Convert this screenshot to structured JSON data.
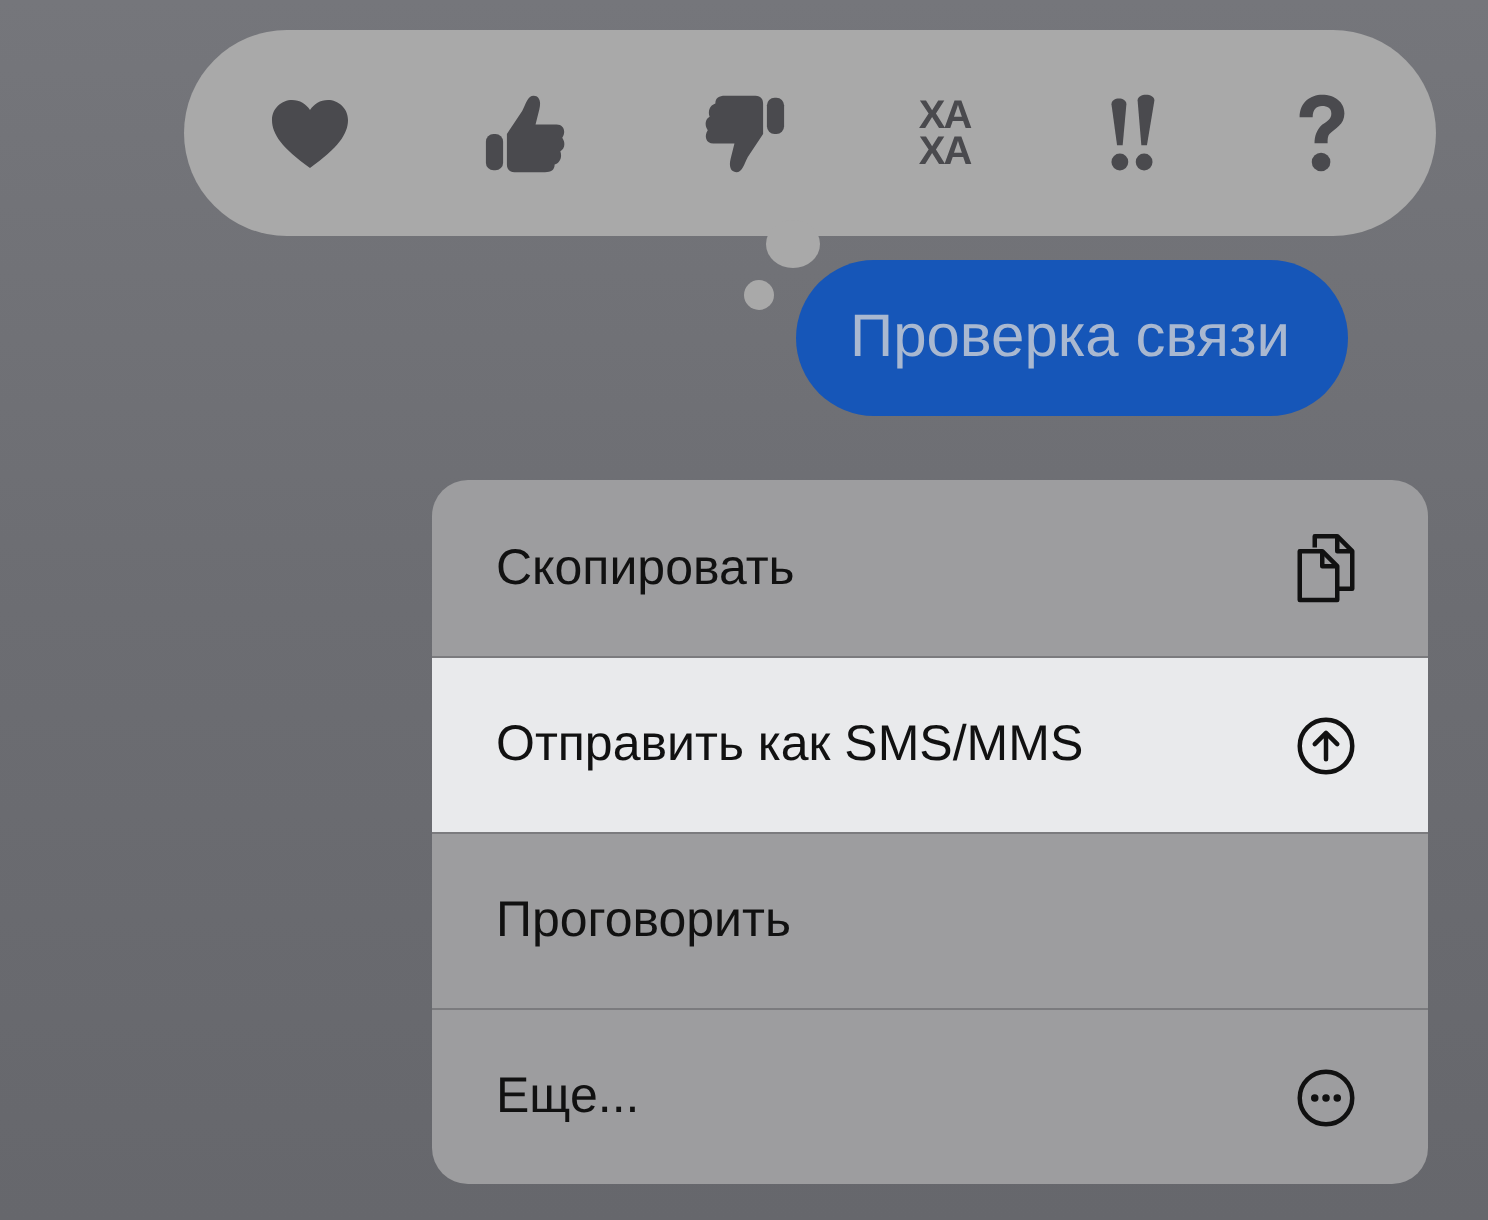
{
  "reactions": [
    {
      "kind": "heart"
    },
    {
      "kind": "thumbs-up"
    },
    {
      "kind": "thumbs-down"
    },
    {
      "kind": "haha",
      "lines": [
        "ХА",
        "ХА"
      ]
    },
    {
      "kind": "exclamation"
    },
    {
      "kind": "question"
    }
  ],
  "message": {
    "text": "Проверка связи"
  },
  "menu": [
    {
      "label": "Скопировать",
      "kind": "copy",
      "selected": false
    },
    {
      "label": "Отправить как SMS/MMS",
      "kind": "send",
      "selected": true
    },
    {
      "label": "Проговорить",
      "kind": "speak",
      "selected": false
    },
    {
      "label": "Еще...",
      "kind": "more",
      "selected": false
    }
  ]
}
